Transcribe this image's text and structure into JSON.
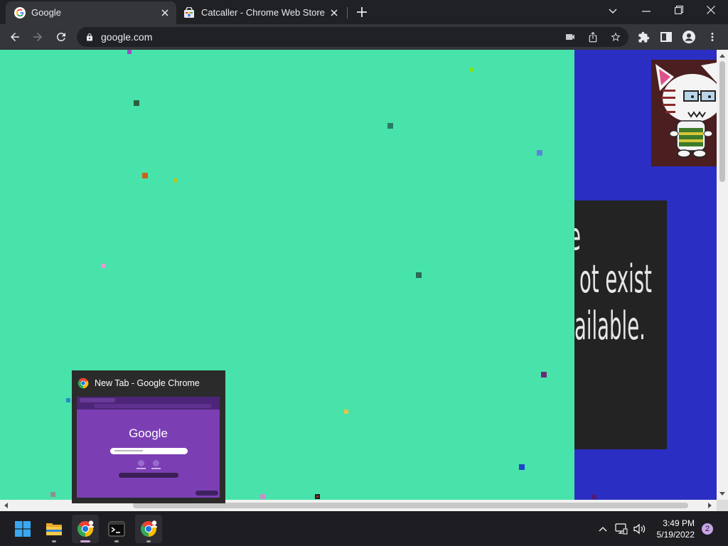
{
  "browser": {
    "tabs": [
      {
        "title": "Google",
        "favicon": "google-g-icon",
        "active": true
      },
      {
        "title": "Catcaller - Chrome Web Store",
        "favicon": "chrome-web-store-icon",
        "active": false
      }
    ],
    "new_tab_icon": "plus-icon",
    "window_controls": [
      "tab-search-chevron-icon",
      "minimize-icon",
      "restore-icon",
      "close-icon"
    ]
  },
  "toolbar": {
    "url": "google.com",
    "nav_icons": [
      "back-arrow-icon",
      "forward-arrow-icon",
      "reload-icon"
    ],
    "forward_enabled": false,
    "omnibox_icons": [
      "lock-icon",
      "video-camera-icon",
      "share-icon",
      "bookmark-star-icon"
    ],
    "right_icons": [
      "extensions-puzzle-icon",
      "side-panel-icon",
      "profile-icon",
      "menu-dots-icon"
    ]
  },
  "page": {
    "background_color": "#48e3ab",
    "panel_color": "#2b2ec2",
    "message_box_color": "#232323",
    "message_lines": [
      "e",
      "ot exist",
      "ailable."
    ],
    "image": "catcaller-cat-icon"
  },
  "taskbar_preview": {
    "title": "New Tab - Google Chrome",
    "app_icon": "chrome-icon",
    "thumbnail": {
      "logo_text": "Google",
      "background_color": "#7b3fb3"
    }
  },
  "taskbar": {
    "apps": [
      "start-windows-icon",
      "file-explorer-icon",
      "chrome-profile-icon",
      "terminal-icon",
      "chrome-profile-icon"
    ],
    "tray_icons": [
      "show-hidden-chevron-icon",
      "network-icon",
      "volume-icon"
    ],
    "time": "3:49 PM",
    "date": "5/19/2022",
    "notification_count": "2"
  }
}
